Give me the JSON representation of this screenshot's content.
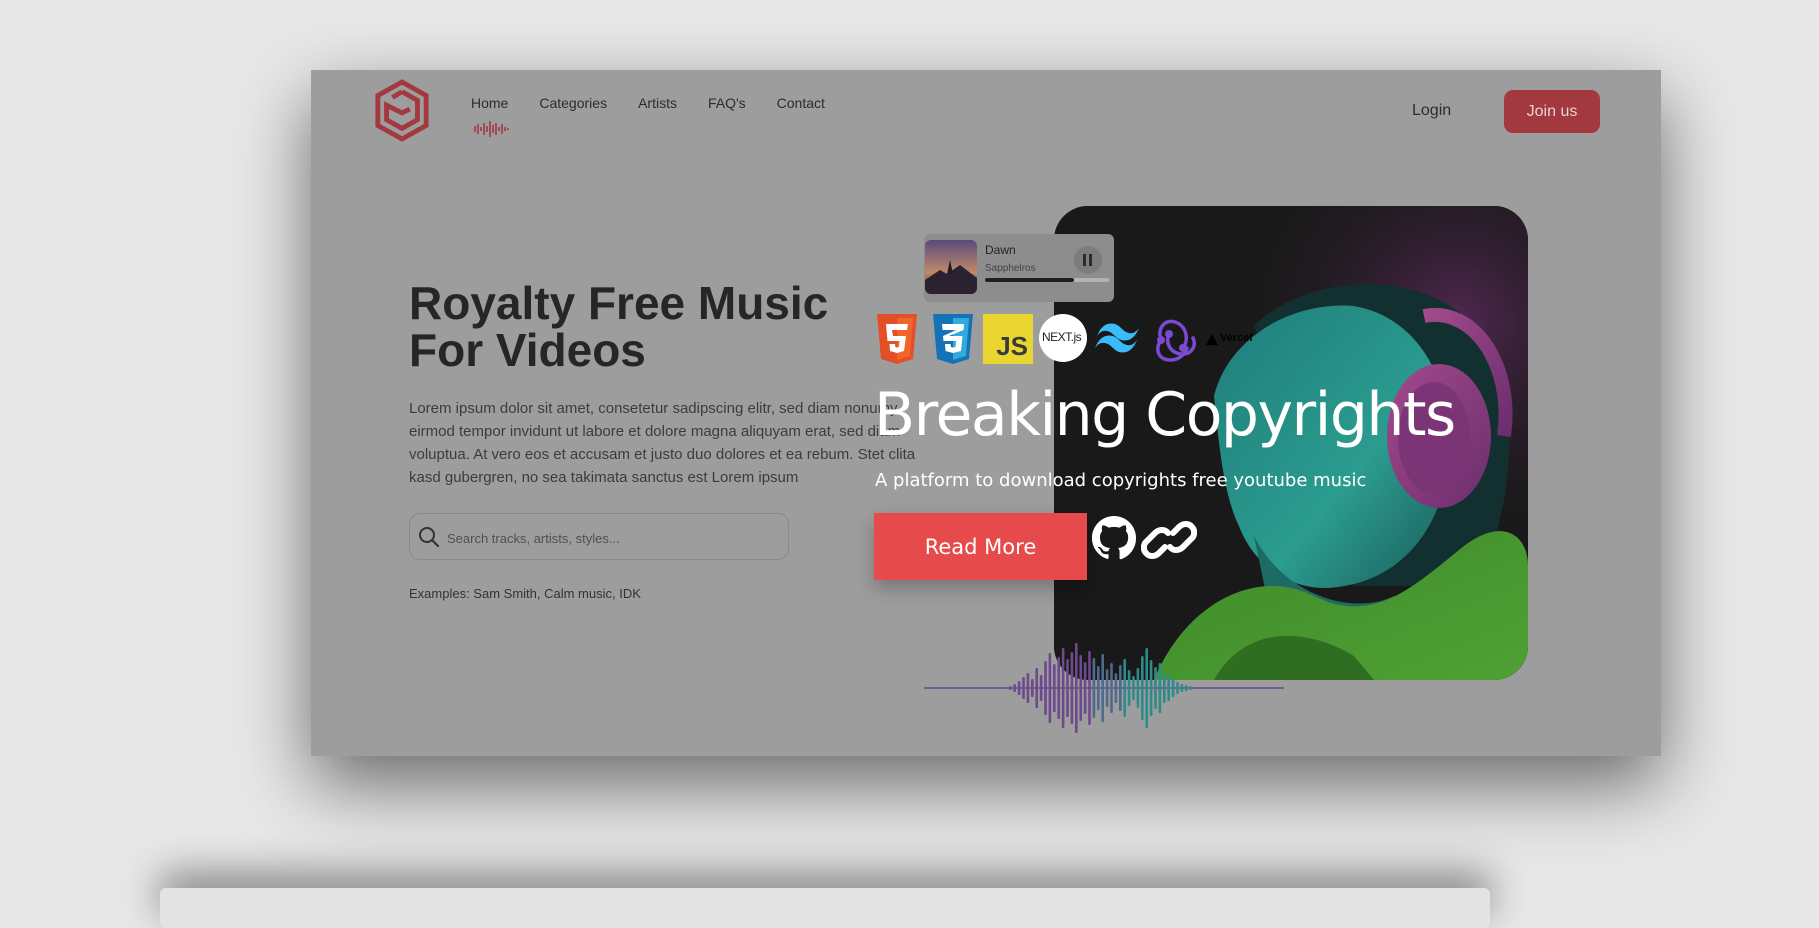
{
  "nav": {
    "items": [
      {
        "label": "Home"
      },
      {
        "label": "Categories"
      },
      {
        "label": "Artists"
      },
      {
        "label": "FAQ's"
      },
      {
        "label": "Contact"
      }
    ],
    "login_label": "Login",
    "join_label": "Join us"
  },
  "hero": {
    "title": "Royalty Free Music For Videos",
    "description": "Lorem ipsum dolor sit amet, consetetur sadipscing elitr, sed diam nonumy eirmod tempor invidunt ut labore et dolore magna aliquyam erat, sed diam voluptua. At vero eos et accusam et justo duo dolores et ea rebum. Stet clita kasd gubergren, no sea takimata sanctus est Lorem ipsum",
    "search_placeholder": "Search tracks, artists, styles...",
    "examples": "Examples: Sam Smith, Calm music, IDK"
  },
  "player": {
    "title": "Dawn",
    "artist": "Sapphelros",
    "progress": 0.72
  },
  "tech_stack": {
    "icons": [
      "html5-icon",
      "css3-icon",
      "javascript-icon",
      "nextjs-icon",
      "tailwind-icon",
      "redux-icon",
      "vercel-icon"
    ],
    "js_label": "JS",
    "next_label": "NEXT.js",
    "vercel_label": "Vercel"
  },
  "overlay": {
    "title": "Breaking Copyrights",
    "subtitle": "A platform to download copyrights free youtube music",
    "read_more_label": "Read More"
  },
  "colors": {
    "brand_red": "#a3383f",
    "button_red": "#e64a4a",
    "frame_gray": "#9d9d9d",
    "page_bg": "#e8e8e8"
  }
}
